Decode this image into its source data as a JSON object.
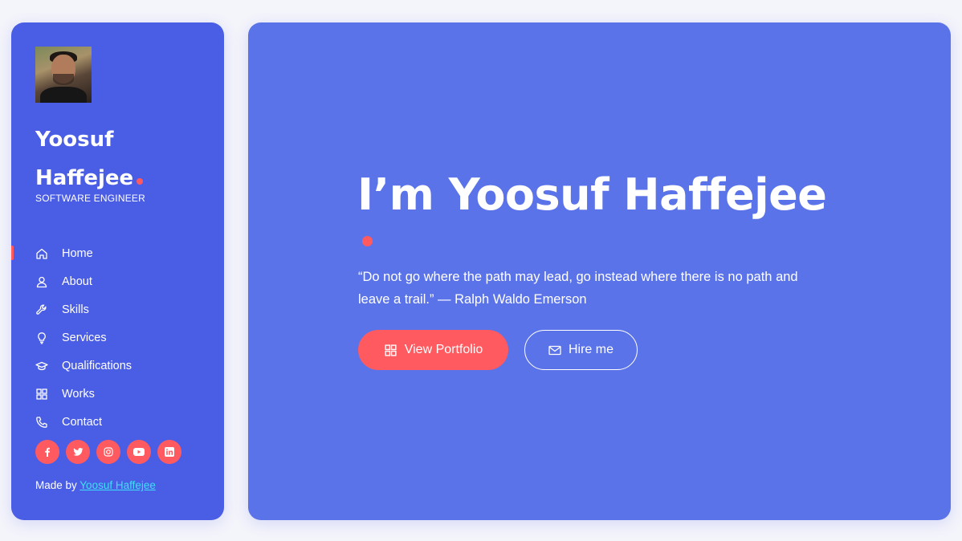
{
  "sidebar": {
    "name_line1": "Yoosuf",
    "name_line2": "Haffejee",
    "role": "SOFTWARE ENGINEER",
    "nav": [
      {
        "label": "Home",
        "icon": "home-icon",
        "active": true
      },
      {
        "label": "About",
        "icon": "user-icon",
        "active": false
      },
      {
        "label": "Skills",
        "icon": "wrench-icon",
        "active": false
      },
      {
        "label": "Services",
        "icon": "lightbulb-icon",
        "active": false
      },
      {
        "label": "Qualifications",
        "icon": "graduation-cap-icon",
        "active": false
      },
      {
        "label": "Works",
        "icon": "grid-icon",
        "active": false
      },
      {
        "label": "Contact",
        "icon": "phone-icon",
        "active": false
      }
    ],
    "socials": [
      "facebook-icon",
      "twitter-icon",
      "instagram-icon",
      "youtube-icon",
      "linkedin-icon"
    ],
    "made_by_prefix": "Made by",
    "made_by_link": "Yoosuf Haffejee"
  },
  "hero": {
    "headline": "I’m Yoosuf Haffejee",
    "quote": "“Do not go where the path may lead, go instead where there is no path and leave a trail.” — Ralph Waldo Emerson",
    "primary_button": "View Portfolio",
    "secondary_button": "Hire me"
  },
  "colors": {
    "sidebar_bg": "#4a5de5",
    "main_bg": "#5b73e8",
    "accent": "#ff5a5f",
    "link": "#3ee0f5",
    "page_bg": "#f4f4fb"
  }
}
